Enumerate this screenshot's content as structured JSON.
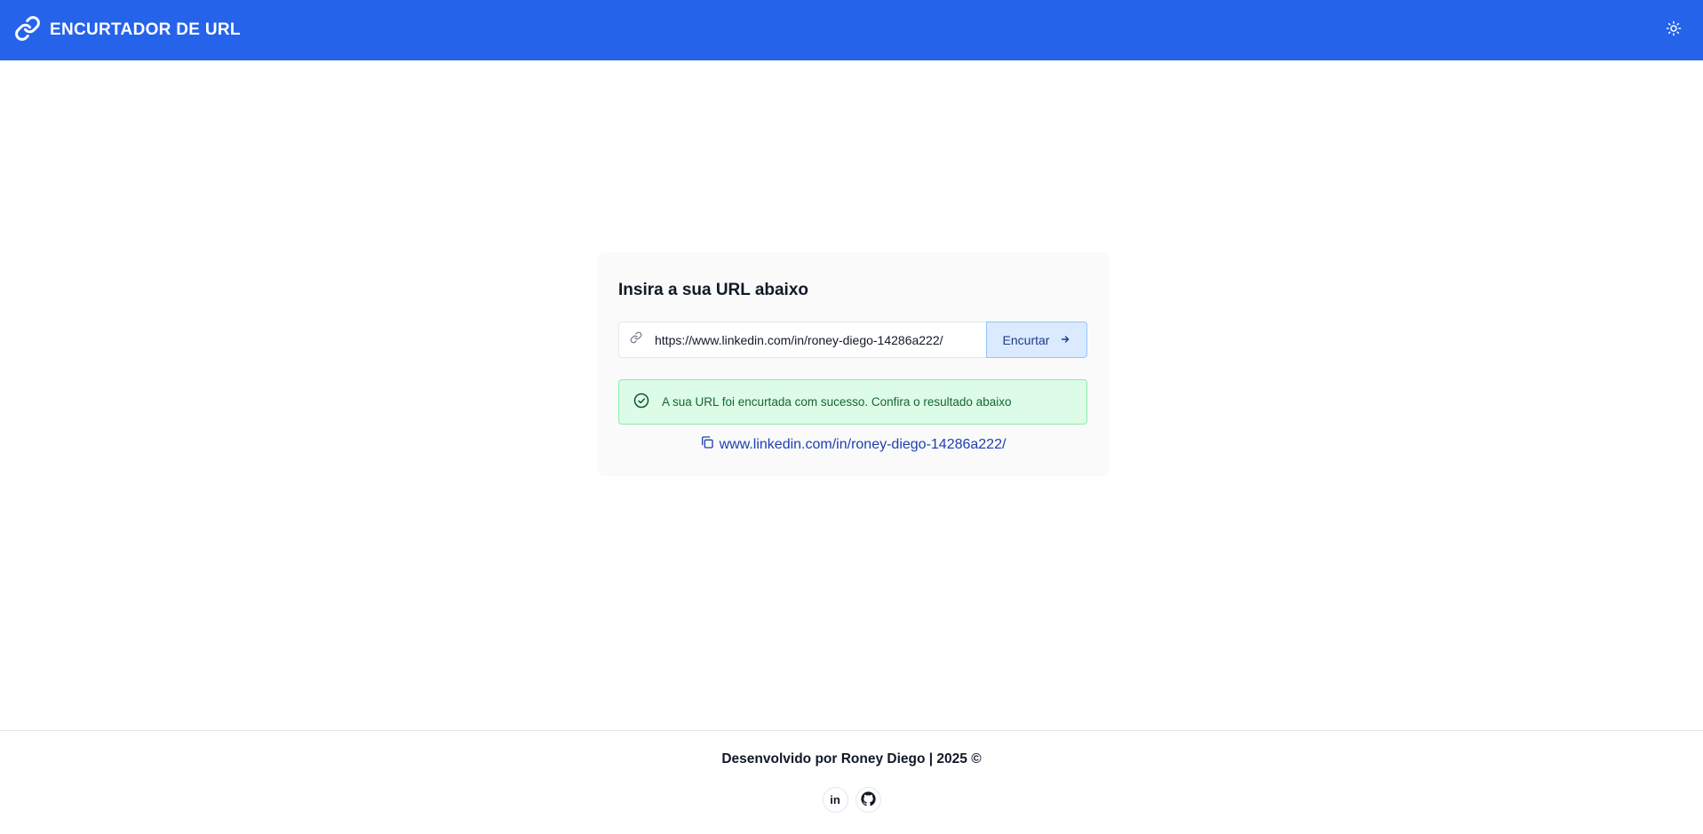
{
  "header": {
    "title": "ENCURTADOR DE URL",
    "logo_icon": "link-icon",
    "theme_icon": "sun-icon"
  },
  "card": {
    "title": "Insira a sua URL abaixo",
    "input": {
      "icon": "link-icon",
      "value": "https://www.linkedin.com/in/roney-diego-14286a222/"
    },
    "button": {
      "label": "Encurtar",
      "icon": "arrow-right-icon"
    },
    "alert": {
      "icon": "check-circle-icon",
      "message": "A sua URL foi encurtada com sucesso. Confira o resultado abaixo"
    },
    "result": {
      "icon": "copy-icon",
      "url": "www.linkedin.com/in/roney-diego-14286a222/"
    }
  },
  "footer": {
    "credit": "Desenvolvido por Roney Diego | 2025 ©",
    "socials": [
      {
        "name": "linkedin-icon",
        "label": "in"
      },
      {
        "name": "github-icon",
        "label": ""
      }
    ]
  },
  "colors": {
    "header_bg": "#2563eb",
    "alert_bg": "#dcfce7",
    "alert_text": "#166534",
    "button_bg": "#dbeafe",
    "link": "#1e40af"
  }
}
